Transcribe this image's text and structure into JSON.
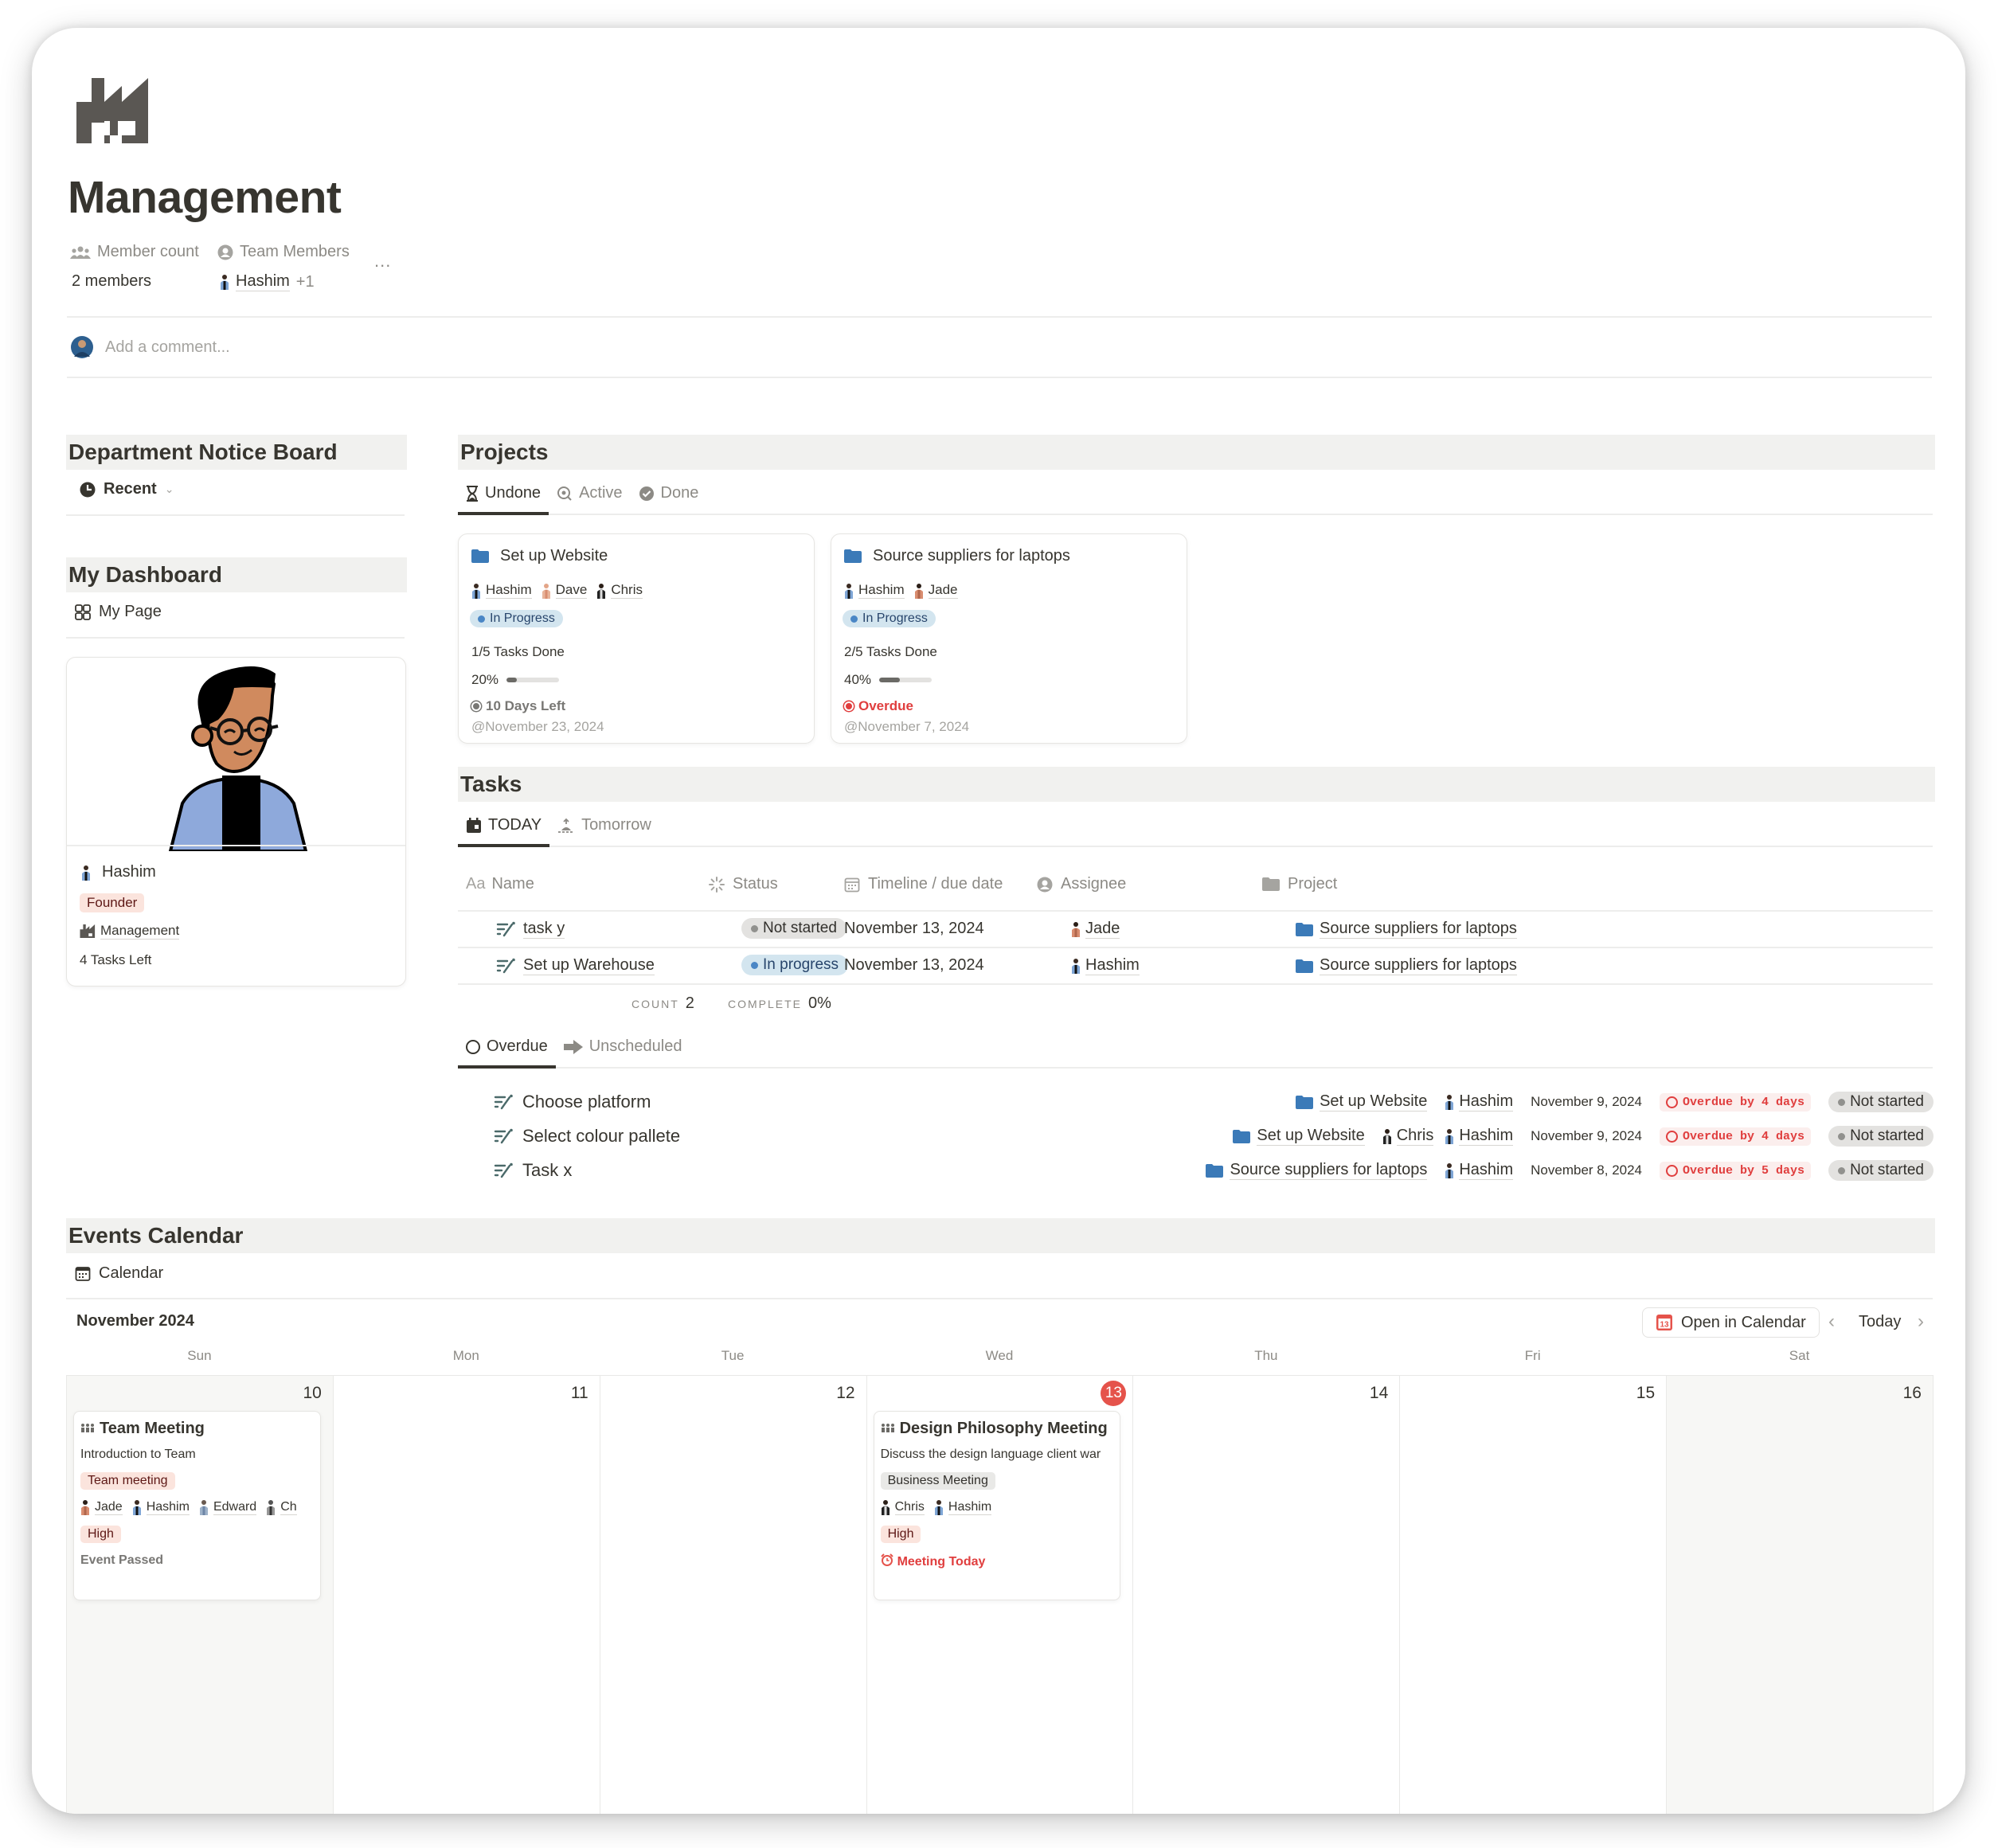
{
  "page": {
    "icon": "factory-icon",
    "title": "Management",
    "properties": {
      "member_count_label": "Member count",
      "member_count_value": "2 members",
      "team_members_label": "Team Members",
      "team_members_value": "Hashim",
      "team_members_more": "+1",
      "more_label": "..."
    },
    "comment_placeholder": "Add a comment..."
  },
  "notice_board": {
    "title": "Department Notice Board",
    "view_label": "Recent"
  },
  "dashboard": {
    "title": "My Dashboard",
    "view_label": "My Page",
    "profile": {
      "name": "Hashim",
      "role": "Founder",
      "department": "Management",
      "tasks_left": "4 Tasks Left"
    }
  },
  "projects": {
    "title": "Projects",
    "tabs": [
      {
        "label": "Undone",
        "icon": "hourglass-icon",
        "active": true
      },
      {
        "label": "Active",
        "icon": "search-cycle-icon",
        "active": false
      },
      {
        "label": "Done",
        "icon": "check-circle-icon",
        "active": false
      }
    ],
    "cards": [
      {
        "name": "Set up Website",
        "members": [
          "Hashim",
          "Dave",
          "Chris"
        ],
        "status": "In Progress",
        "tasks_done": "1/5 Tasks Done",
        "progress_label": "20%",
        "progress": 0.2,
        "deadline_status": "10 Days Left",
        "deadline_status_color": "#787774",
        "date": "@November 23, 2024"
      },
      {
        "name": "Source suppliers for laptops",
        "members": [
          "Hashim",
          "Jade"
        ],
        "status": "In Progress",
        "tasks_done": "2/5 Tasks Done",
        "progress_label": "40%",
        "progress": 0.4,
        "deadline_status": "Overdue",
        "deadline_status_color": "#e03e3e",
        "date": "@November 7, 2024"
      }
    ]
  },
  "tasks": {
    "title": "Tasks",
    "tabs": [
      {
        "label": "TODAY",
        "icon": "calendar-today-icon",
        "active": true
      },
      {
        "label": "Tomorrow",
        "icon": "sunrise-icon",
        "active": false
      }
    ],
    "columns": {
      "name": "Name",
      "name_prefix": "Aa",
      "status": "Status",
      "timeline": "Timeline / due date",
      "assignee": "Assignee",
      "project": "Project"
    },
    "rows": [
      {
        "name": "task y",
        "status": "Not started",
        "status_kind": "gray",
        "date": "November 13, 2024",
        "assignee": "Jade",
        "project": "Source suppliers for laptops"
      },
      {
        "name": "Set up Warehouse",
        "status": "In progress",
        "status_kind": "blue",
        "date": "November 13, 2024",
        "assignee": "Hashim",
        "project": "Source suppliers for laptops"
      }
    ],
    "footer": {
      "count_label": "COUNT",
      "count_value": "2",
      "complete_label": "COMPLETE",
      "complete_value": "0%"
    }
  },
  "overdue": {
    "tabs": [
      {
        "label": "Overdue",
        "icon": "circle-outline-icon",
        "active": true
      },
      {
        "label": "Unscheduled",
        "icon": "arrow-right-icon",
        "active": false
      }
    ],
    "rows": [
      {
        "name": "Choose platform",
        "project": "Set up Website",
        "assignees": [
          "Hashim"
        ],
        "date": "November 9, 2024",
        "overdue": "Overdue by 4 days",
        "status": "Not started"
      },
      {
        "name": "Select colour pallete",
        "project": "Set up Website",
        "assignees": [
          "Chris",
          "Hashim"
        ],
        "date": "November 9, 2024",
        "overdue": "Overdue by 4 days",
        "status": "Not started"
      },
      {
        "name": "Task x",
        "project": "Source suppliers for laptops",
        "assignees": [
          "Hashim"
        ],
        "date": "November 8, 2024",
        "overdue": "Overdue by 5 days",
        "status": "Not started"
      }
    ]
  },
  "calendar": {
    "title": "Events Calendar",
    "view_label": "Calendar",
    "month_label": "November 2024",
    "open_button": "Open in Calendar",
    "open_button_icon_day": "13",
    "today_button": "Today",
    "weekdays": [
      "Sun",
      "Mon",
      "Tue",
      "Wed",
      "Thu",
      "Fri",
      "Sat"
    ],
    "days": [
      "10",
      "11",
      "12",
      "13",
      "14",
      "15",
      "16"
    ],
    "today_index": 3,
    "events": [
      {
        "day_index": 0,
        "title": "Team Meeting",
        "description": "Introduction to Team",
        "type": "Team meeting",
        "type_kind": "red",
        "attendees": [
          "Jade",
          "Hashim",
          "Edward",
          "Ch"
        ],
        "priority": "High",
        "status": "Event Passed",
        "status_color": "#787774",
        "status_icon": ""
      },
      {
        "day_index": 3,
        "title": "Design Philosophy Meeting",
        "description": "Discuss the design language client war",
        "type": "Business Meeting",
        "type_kind": "gray",
        "attendees": [
          "Chris",
          "Hashim"
        ],
        "priority": "High",
        "status": "Meeting Today",
        "status_color": "#e03e3e",
        "status_icon": "alarm-clock-icon"
      }
    ]
  }
}
